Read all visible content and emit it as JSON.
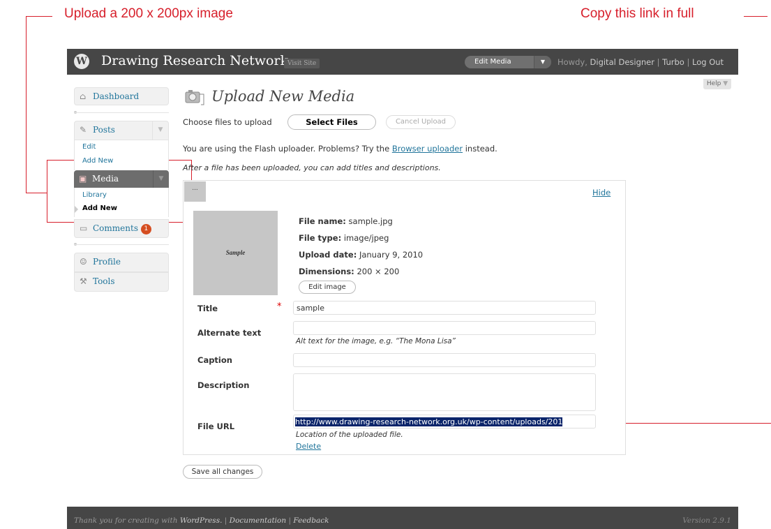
{
  "annotations": {
    "upload_note": "Upload a 200 x 200px image",
    "copy_note": "Copy this link in full"
  },
  "header": {
    "site_name": "Drawing Research Network",
    "visit_site": "Visit Site",
    "edit_media": "Edit Media",
    "howdy_prefix": "Howdy,",
    "user": "Digital Designer",
    "turbo": "Turbo",
    "logout": "Log Out",
    "sep": "|"
  },
  "help": "Help",
  "sidebar": {
    "dashboard": "Dashboard",
    "posts": "Posts",
    "posts_edit": "Edit",
    "posts_add_new": "Add New",
    "media": "Media",
    "media_library": "Library",
    "media_add_new": "Add New",
    "comments": "Comments",
    "comments_count": "1",
    "profile": "Profile",
    "tools": "Tools"
  },
  "page": {
    "title": "Upload New Media",
    "choose_label": "Choose files to upload",
    "select_files": "Select Files",
    "cancel_upload": "Cancel Upload",
    "flash_notice_pre": "You are using the Flash uploader. Problems? Try the",
    "flash_notice_link": "Browser uploader",
    "flash_notice_post": "instead.",
    "after_upload": "After a file has been uploaded, you can add titles and descriptions.",
    "save_all": "Save all changes"
  },
  "media_item": {
    "ellipsis": "...",
    "hide": "Hide",
    "thumb_text": "Sample",
    "file_name_label": "File name:",
    "file_name": "sample.jpg",
    "file_type_label": "File type:",
    "file_type": "image/jpeg",
    "upload_date_label": "Upload date:",
    "upload_date": "January 9, 2010",
    "dimensions_label": "Dimensions:",
    "dimensions": "200 × 200",
    "edit_image": "Edit image",
    "title_label": "Title",
    "required_mark": "*",
    "title_value": "sample",
    "alt_label": "Alternate text",
    "alt_value": "",
    "alt_help": "Alt text for the image, e.g. “The Mona Lisa”",
    "caption_label": "Caption",
    "caption_value": "",
    "description_label": "Description",
    "description_value": "",
    "file_url_label": "File URL",
    "file_url": "http://www.drawing-research-network.org.uk/wp-content/uploads/201",
    "file_url_help": "Location of the uploaded file.",
    "delete": "Delete"
  },
  "footer": {
    "thanks_pre": "Thank you for creating with",
    "wordpress": "WordPress.",
    "documentation": "Documentation",
    "feedback": "Feedback",
    "sep": "|",
    "version": "Version 2.9.1"
  },
  "colors": {
    "annotation": "#d71f2b",
    "header_bg": "#464646",
    "link": "#21759b",
    "badge": "#d54e21"
  }
}
